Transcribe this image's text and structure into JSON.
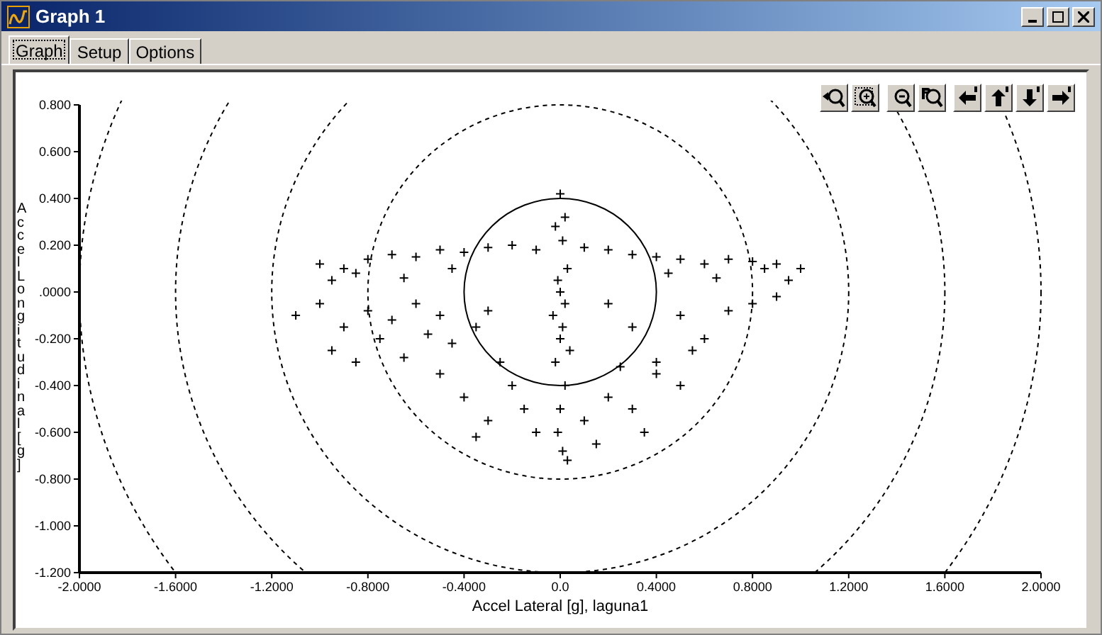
{
  "window": {
    "title": "Graph 1"
  },
  "tabs": [
    {
      "label": "Graph",
      "selected": true
    },
    {
      "label": "Setup",
      "selected": false
    },
    {
      "label": "Options",
      "selected": false
    }
  ],
  "toolbar": [
    {
      "kind": "zoom-back"
    },
    {
      "kind": "zoom-box"
    },
    {
      "kind": "zoom-out"
    },
    {
      "kind": "zoom-reset"
    },
    {
      "kind": "pan-left"
    },
    {
      "kind": "pan-up"
    },
    {
      "kind": "pan-down"
    },
    {
      "kind": "pan-right"
    }
  ],
  "chart": {
    "chart_data": {
      "type": "scatter",
      "xlabel": "Accel Lateral [g], laguna1",
      "ylabel": "Accel Longitudinal [g]",
      "xlim": [
        -2,
        2
      ],
      "ylim": [
        -1.2,
        0.8
      ],
      "xticks": [
        {
          "value": -2,
          "label": "-2.0000"
        },
        {
          "value": -1.6,
          "label": "-1.6000"
        },
        {
          "value": -1.2,
          "label": "-1.2000"
        },
        {
          "value": -0.8,
          "label": "-0.8000"
        },
        {
          "value": -0.4,
          "label": "-0.4000"
        },
        {
          "value": 0,
          "label": "0.0"
        },
        {
          "value": 0.4,
          "label": "0.4000"
        },
        {
          "value": 0.8,
          "label": "0.8000"
        },
        {
          "value": 1.2,
          "label": "1.2000"
        },
        {
          "value": 1.6,
          "label": "1.6000"
        },
        {
          "value": 2,
          "label": "2.0000"
        }
      ],
      "yticks": [
        {
          "value": 0.8,
          "label": "0.800"
        },
        {
          "value": 0.6,
          "label": "0.600"
        },
        {
          "value": 0.4,
          "label": "0.400"
        },
        {
          "value": 0.2,
          "label": "0.200"
        },
        {
          "value": 0,
          "label": ".0000"
        },
        {
          "value": -0.2,
          "label": "-0.200"
        },
        {
          "value": -0.4,
          "label": "-0.400"
        },
        {
          "value": -0.6,
          "label": "-0.600"
        },
        {
          "value": -0.8,
          "label": "-0.800"
        },
        {
          "value": -1,
          "label": "-1.000"
        },
        {
          "value": -1.2,
          "label": "-1.200"
        }
      ],
      "x": [
        -1.0,
        -0.9,
        -0.8,
        -0.7,
        -0.6,
        -0.5,
        -0.4,
        -0.3,
        -0.2,
        -0.1,
        0.1,
        0.2,
        0.3,
        0.4,
        0.5,
        0.6,
        0.7,
        0.8,
        0.9,
        1.0,
        -0.85,
        -0.65,
        -0.45,
        0.45,
        0.65,
        0.85,
        0.95,
        -0.95,
        -1.1,
        -1.0,
        -0.9,
        -0.8,
        -0.75,
        -0.7,
        -0.6,
        -0.55,
        -0.5,
        -0.45,
        -0.35,
        -0.3,
        -0.95,
        -0.85,
        -0.65,
        0,
        0.02,
        -0.02,
        0.01,
        0.03,
        -0.01,
        0,
        0.02,
        -0.03,
        0.01,
        0,
        0.04,
        -0.02,
        0.02,
        0,
        -0.01,
        0.01,
        0.03,
        0.2,
        0.3,
        0.5,
        0.6,
        0.7,
        0.8,
        0.9,
        0.4,
        0.55,
        -0.5,
        -0.4,
        -0.3,
        -0.2,
        -0.1,
        0.1,
        0.2,
        0.3,
        0.4,
        0.5,
        -0.35,
        -0.15,
        0.15,
        0.35,
        -0.25,
        0.25
      ],
      "series": [
        {
          "color": "#000000",
          "values": [
            0.12,
            0.1,
            0.14,
            0.16,
            0.15,
            0.18,
            0.17,
            0.19,
            0.2,
            0.18,
            0.19,
            0.18,
            0.16,
            0.15,
            0.14,
            0.12,
            0.14,
            0.13,
            0.12,
            0.1,
            0.08,
            0.06,
            0.1,
            0.08,
            0.06,
            0.1,
            0.05,
            0.05,
            -0.1,
            -0.05,
            -0.15,
            -0.08,
            -0.2,
            -0.12,
            -0.05,
            -0.18,
            -0.1,
            -0.22,
            -0.15,
            -0.08,
            -0.25,
            -0.3,
            -0.28,
            0.42,
            0.32,
            0.28,
            0.22,
            0.1,
            0.05,
            0,
            -0.05,
            -0.1,
            -0.15,
            -0.2,
            -0.25,
            -0.3,
            -0.4,
            -0.5,
            -0.6,
            -0.68,
            -0.72,
            -0.05,
            -0.15,
            -0.1,
            -0.2,
            -0.08,
            -0.05,
            -0.02,
            -0.3,
            -0.25,
            -0.35,
            -0.45,
            -0.55,
            -0.4,
            -0.6,
            -0.55,
            -0.45,
            -0.5,
            -0.35,
            -0.4,
            -0.62,
            -0.5,
            -0.65,
            -0.6,
            -0.3,
            -0.32
          ]
        }
      ]
    }
  }
}
